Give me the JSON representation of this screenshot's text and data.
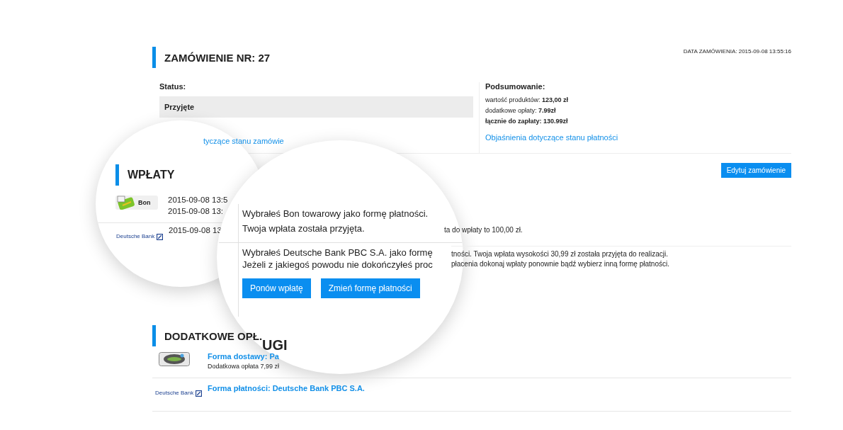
{
  "order": {
    "title": "ZAMÓWIENIE NR: 27",
    "date": "DATA ZAMÓWIENIA: 2015-09-08 13:55:16"
  },
  "status": {
    "label": "Status:",
    "value": "Przyjęte",
    "link": "tyczące stanu zamówie"
  },
  "summary": {
    "title": "Podsumowanie:",
    "lines": [
      {
        "label": "wartość produktów: ",
        "value": "123,00 zł",
        "kind": "normal"
      },
      {
        "label": "dodatkowe opłaty: ",
        "value": "7.99zł",
        "kind": "normal"
      },
      {
        "label": "łącznie do zapłaty: ",
        "value": "130.99zł",
        "kind": "total"
      }
    ],
    "link": "Objaśnienia dotyczące stanu płatności"
  },
  "edit_button": "Edytuj zamówienie",
  "payments_visible": {
    "row_1": "ta do wpłaty to 100,00 zł.",
    "row_2_lines": [
      "tności. Twoja wpłata wysokości 30,99 zł została przyjęta do realizacji.",
      "płacenia dokonaj wpłaty ponownie bądź wybierz inną formę płatności."
    ]
  },
  "extras": {
    "title": "DODATKOWE OPŁ.",
    "rows": [
      {
        "kind": "delivery",
        "title": "Forma dostawy: Pa",
        "note": "Dodatkowa opłata 7,99 zł"
      },
      {
        "kind": "bank",
        "logo_text": "Deutsche Bank",
        "title": "Forma płatności: Deutsche Bank PBC S.A."
      }
    ]
  },
  "magnifier_small": {
    "title": "WPŁATY",
    "rows": [
      {
        "kind": "bon",
        "logo_text": "Bon",
        "dates": [
          "2015-09-08 13:5",
          "2015-09-08 13:"
        ]
      },
      {
        "kind": "bank",
        "logo_text": "Deutsche Bank",
        "dates": [
          "2015-09-08 13"
        ]
      }
    ]
  },
  "magnifier_large": {
    "rows": [
      {
        "lines": [
          "Wybrałeś Bon towarowy jako formę płatności.",
          "Twoja wpłata została przyjęta."
        ]
      },
      {
        "lines": [
          "Wybrałeś Deutsche Bank PBC S.A. jako formę",
          "Jeżeli z jakiegoś powodu nie dokończyłeś proc"
        ],
        "buttons": [
          "Ponów wpłatę",
          "Zmień formę płatności"
        ]
      }
    ],
    "fragment": "UGI"
  }
}
